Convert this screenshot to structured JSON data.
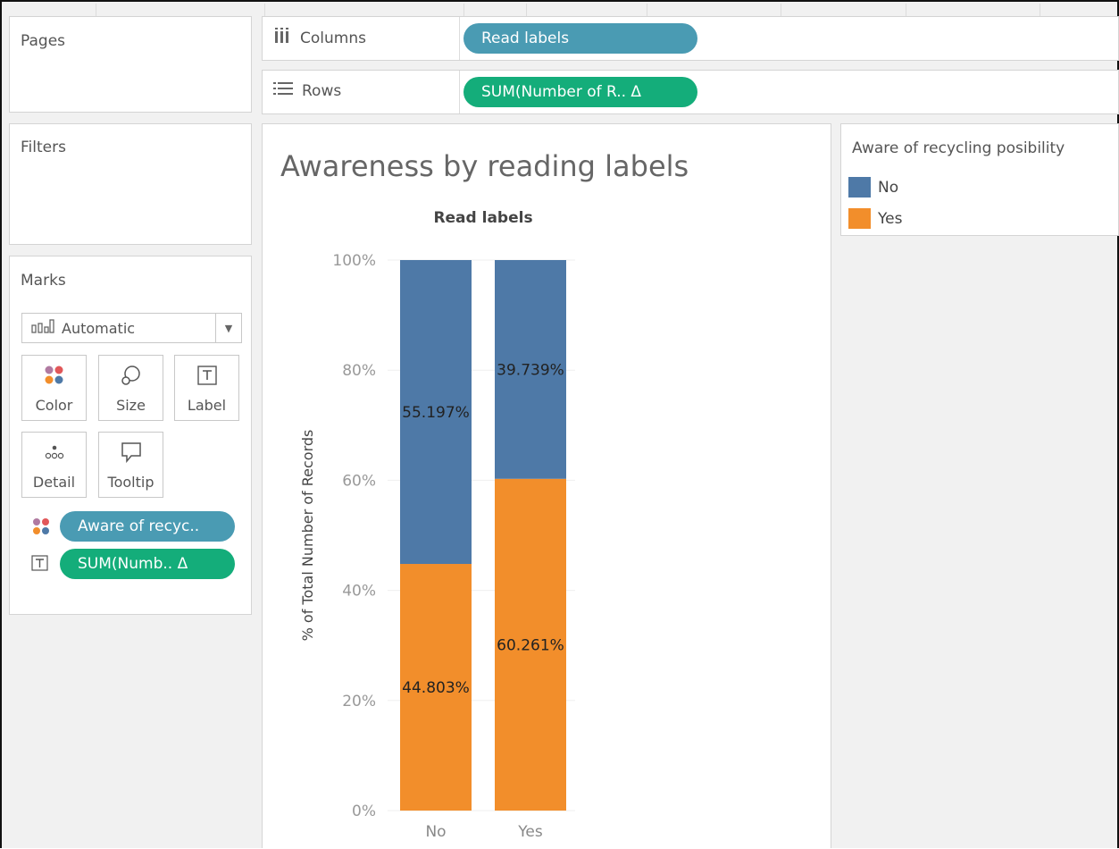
{
  "shelves": {
    "pages_title": "Pages",
    "filters_title": "Filters",
    "columns": {
      "label": "Columns",
      "pill": "Read labels"
    },
    "rows": {
      "label": "Rows",
      "pill": "SUM(Number of R.. Δ"
    }
  },
  "marks": {
    "title": "Marks",
    "mark_type": "Automatic",
    "buttons": {
      "color": "Color",
      "size": "Size",
      "label": "Label",
      "detail": "Detail",
      "tooltip": "Tooltip"
    },
    "color_pill": "Aware of recyc..",
    "label_pill": "SUM(Numb.. Δ"
  },
  "legend": {
    "title": "Aware of recycling posibility",
    "items": [
      {
        "label": "No",
        "color": "#4e79a7"
      },
      {
        "label": "Yes",
        "color": "#f28e2b"
      }
    ]
  },
  "chart_data": {
    "type": "bar",
    "stacked": true,
    "title": "Awareness by reading labels",
    "column_header": "Read labels",
    "ylabel": "% of Total Number of Records",
    "xlabel": "",
    "categories": [
      "No",
      "Yes"
    ],
    "ylim": [
      0,
      100
    ],
    "y_ticks": [
      "0%",
      "20%",
      "40%",
      "60%",
      "80%",
      "100%"
    ],
    "series": [
      {
        "name": "Yes",
        "color": "#f28e2b",
        "values": [
          44.803,
          60.261
        ],
        "labels": [
          "44.803%",
          "60.261%"
        ]
      },
      {
        "name": "No",
        "color": "#4e79a7",
        "values": [
          55.197,
          39.739
        ],
        "labels": [
          "55.197%",
          "39.739%"
        ]
      }
    ],
    "grid": true,
    "legend_position": "right"
  }
}
